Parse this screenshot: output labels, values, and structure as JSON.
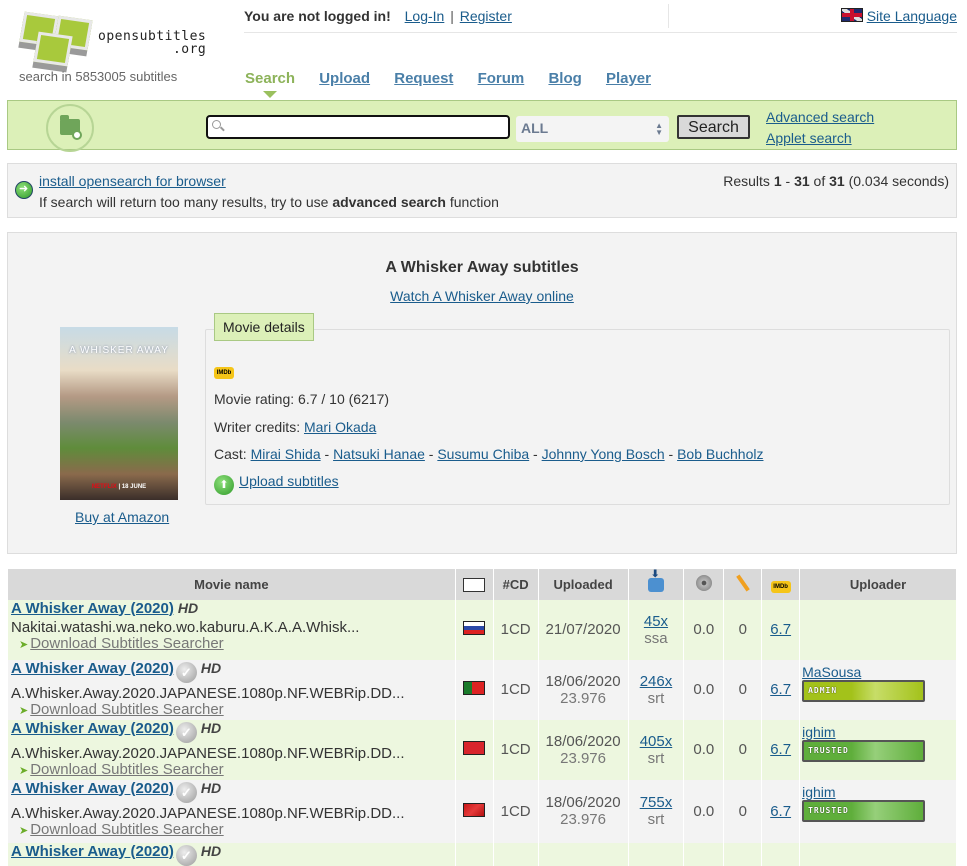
{
  "header": {
    "logo_text_1": "opensubtitles",
    "logo_text_2": ".org",
    "subtitle_count_text": "search in 5853005 subtitles",
    "login_status": "You are not logged in!",
    "login_link": "Log-In",
    "separator": "|",
    "register_link": "Register",
    "site_language": "Site Language",
    "language_flag_icon": "uk-flag-icon"
  },
  "nav": {
    "items": [
      {
        "label": "Search",
        "active": true
      },
      {
        "label": "Upload",
        "active": false
      },
      {
        "label": "Request",
        "active": false
      },
      {
        "label": "Forum",
        "active": false
      },
      {
        "label": "Blog",
        "active": false
      },
      {
        "label": "Player",
        "active": false
      }
    ]
  },
  "search": {
    "query_value": "",
    "placeholder": "",
    "language_select": "ALL",
    "button_label": "Search",
    "advanced_link": "Advanced search",
    "applet_link": "Applet search"
  },
  "info": {
    "opensearch_link": "install opensearch for browser",
    "hint_prefix": "If search will return too many results, try to use ",
    "hint_bold": "advanced search",
    "hint_suffix": " function",
    "results_prefix": "Results ",
    "results_from": "1",
    "results_dash": " - ",
    "results_to": "31",
    "results_of": " of ",
    "results_total": "31",
    "results_time": " (0.034 seconds)"
  },
  "movie": {
    "title": "A Whisker Away subtitles",
    "watch_link": "Watch A Whisker Away online",
    "poster_title": "A WHISKER AWAY",
    "poster_netflix": "NETFLIX",
    "poster_date": "18 JUNE",
    "buy_link": "Buy at Amazon",
    "details_legend": "Movie details",
    "imdb_label": "IMDb",
    "rating_text": "Movie rating: 6.7 / 10 (6217)",
    "writer_label": "Writer credits: ",
    "writer": "Mari Okada",
    "cast_label": "Cast: ",
    "cast": [
      "Mirai Shida",
      "Natsuki Hanae",
      "Susumu Chiba",
      "Johnny Yong Bosch",
      "Bob Buchholz"
    ],
    "cast_separator": " - ",
    "upload_link": "Upload subtitles"
  },
  "table": {
    "headers": {
      "movie_name": "Movie name",
      "cd": "#CD",
      "uploaded": "Uploaded",
      "uploader": "Uploader",
      "imdb": "IMDb"
    },
    "rows": [
      {
        "title": "A Whisker Away (2020)",
        "verified": false,
        "hd": "HD",
        "release": "Nakitai.watashi.wa.neko.wo.kaburu.A.K.A.A.Whisk...",
        "download_label": "Download Subtitles Searcher",
        "language": "Russian",
        "flag": "f-ru",
        "cd": "1CD",
        "date": "21/07/2020",
        "fps": "",
        "downloads": "45x",
        "format": "ssa",
        "rating": "0.0",
        "comments": "0",
        "imdb": "6.7",
        "uploader": "",
        "badge": ""
      },
      {
        "title": "A Whisker Away (2020)",
        "verified": true,
        "hd": "HD",
        "release": "A.Whisker.Away.2020.JAPANESE.1080p.NF.WEBRip.DD...",
        "download_label": "Download Subtitles Searcher",
        "language": "Portuguese",
        "flag": "f-pt",
        "cd": "1CD",
        "date": "18/06/2020",
        "fps": "23.976",
        "downloads": "246x",
        "format": "srt",
        "rating": "0.0",
        "comments": "0",
        "imdb": "6.7",
        "uploader": "MaSousa",
        "badge": "ADMIN"
      },
      {
        "title": "A Whisker Away (2020)",
        "verified": true,
        "hd": "HD",
        "release": "A.Whisker.Away.2020.JAPANESE.1080p.NF.WEBRip.DD...",
        "download_label": "Download Subtitles Searcher",
        "language": "Chinese (HK)",
        "flag": "f-hk",
        "cd": "1CD",
        "date": "18/06/2020",
        "fps": "23.976",
        "downloads": "405x",
        "format": "srt",
        "rating": "0.0",
        "comments": "0",
        "imdb": "6.7",
        "uploader": "ighim",
        "badge": "TRUSTED"
      },
      {
        "title": "A Whisker Away (2020)",
        "verified": true,
        "hd": "HD",
        "release": "A.Whisker.Away.2020.JAPANESE.1080p.NF.WEBRip.DD...",
        "download_label": "Download Subtitles Searcher",
        "language": "Chinese",
        "flag": "f-cn",
        "cd": "1CD",
        "date": "18/06/2020",
        "fps": "23.976",
        "downloads": "755x",
        "format": "srt",
        "rating": "0.0",
        "comments": "0",
        "imdb": "6.7",
        "uploader": "ighim",
        "badge": "TRUSTED"
      },
      {
        "title": "A Whisker Away (2020)",
        "verified": true,
        "hd": "HD",
        "release": "",
        "download_label": "",
        "language": "",
        "flag": "",
        "cd": "",
        "date": "",
        "fps": "",
        "downloads": "",
        "format": "",
        "rating": "",
        "comments": "",
        "imdb": "",
        "uploader": "",
        "badge": ""
      }
    ]
  }
}
